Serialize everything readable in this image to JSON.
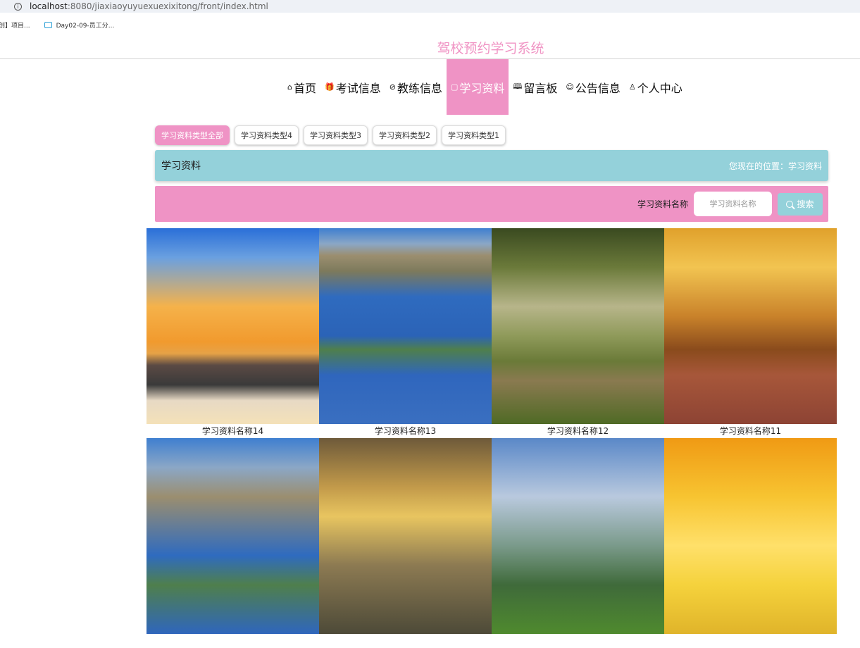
{
  "browser": {
    "url_host": "localhost",
    "url_rest": ":8080/jiaxiaoyuyuexuexixitong/front/index.html",
    "bookmarks": [
      {
        "label": "创】项目..."
      },
      {
        "label": "Day02-09-员工分..."
      }
    ]
  },
  "site": {
    "title": "驾校预约学习系统"
  },
  "nav": {
    "items": [
      {
        "label": "首页",
        "icon": "home-icon",
        "glyph": "⌂"
      },
      {
        "label": "考试信息",
        "icon": "gift-icon",
        "glyph": "🎁"
      },
      {
        "label": "教练信息",
        "icon": "coach-icon",
        "glyph": "⊘"
      },
      {
        "label": "学习资料",
        "icon": "document-icon",
        "glyph": "▢"
      },
      {
        "label": "留言板",
        "icon": "message-icon",
        "glyph": "🕮"
      },
      {
        "label": "公告信息",
        "icon": "notice-icon",
        "glyph": "☺"
      },
      {
        "label": "个人中心",
        "icon": "user-icon",
        "glyph": "♙"
      }
    ],
    "active": "学习资料"
  },
  "filters": {
    "tabs": [
      "学习资料类型全部",
      "学习资料类型4",
      "学习资料类型3",
      "学习资料类型2",
      "学习资料类型1"
    ],
    "active": "学习资料类型全部"
  },
  "section": {
    "title": "学习资料",
    "location": "您现在的位置：学习资料"
  },
  "search": {
    "label": "学习资料名称",
    "placeholder": "学习资料名称",
    "button_label": "搜索"
  },
  "materials": [
    {
      "name": "学习资料名称14",
      "image": "beach-sunset"
    },
    {
      "name": "学习资料名称13",
      "image": "coastline"
    },
    {
      "name": "学习资料名称12",
      "image": "forest-path"
    },
    {
      "name": "学习资料名称11",
      "image": "autumn-trees"
    },
    {
      "name": "",
      "image": "coastline"
    },
    {
      "name": "",
      "image": "mountain-sunrise"
    },
    {
      "name": "",
      "image": "karst-hills"
    },
    {
      "name": "",
      "image": "golden-sky"
    }
  ],
  "colors": {
    "brand_pink": "#ef93c5",
    "accent_teal": "#94d1da"
  }
}
